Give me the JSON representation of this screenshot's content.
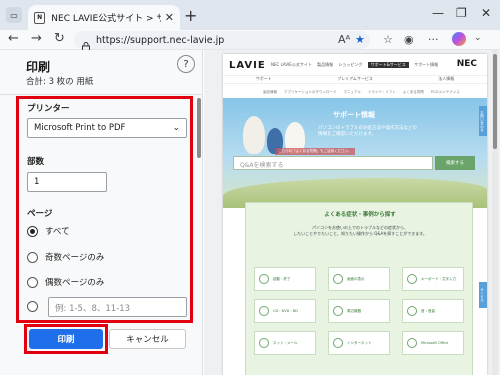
{
  "browser": {
    "tab_title": "NEC LAVIE公式サイト > サービス＆サ",
    "url": "https://support.nec-lavie.jp",
    "favicon_text": "N"
  },
  "dialog": {
    "title": "印刷",
    "subtitle": "合計: 3 枚の 用紙",
    "help_label": "?",
    "printer_label": "プリンター",
    "printer_value": "Microsoft Print to PDF",
    "copies_label": "部数",
    "copies_value": "1",
    "pages_label": "ページ",
    "page_options": [
      "すべて",
      "奇数ページのみ",
      "偶数ページのみ"
    ],
    "range_placeholder": "例: 1-5、8、11-13",
    "print_button": "印刷",
    "cancel_button": "キャンセル"
  },
  "preview": {
    "logo": "LAVIE",
    "brand": "NEC",
    "topnav": [
      "NEC LAVIE公式サイト",
      "製品情報",
      "ショッピング",
      "サポート情報"
    ],
    "topnav_active": "サポート&サービス",
    "subnav": [
      "サポート",
      "プレミアムサービス",
      "法人情報"
    ],
    "subnav2": "製品情報　　アプリケーションのダウンロード　　マニュアル　　ドライバ・ソフト　　よくある質問　　PCのメンテナンス",
    "hero_title": "サポート情報",
    "hero_text": "パソコンのトラブルの対処方法や操作方法などの\n情報をご確認いただけます。",
    "hero_tag": "こちらの「よくある質問」もご活用ください。",
    "search_placeholder": "Q&Aを検索する",
    "search_button": "検索する",
    "side_tab_1": "お問い合わせ",
    "side_tab_2": "サービス",
    "faq_title": "よくある症状・事例から探す",
    "faq_desc": "パソコンをお使いの上でのトラブルなどの症状から、\nしたいことやりたいこと、知りたい操作から Q&Aを探すことができます。",
    "tiles": [
      "起動・終了",
      "画面の表示",
      "キーボード・文字入力",
      "CD・DVD・BD",
      "周辺機器",
      "音・音量",
      "ネット・メール",
      "インターネット",
      "Microsoft Office"
    ]
  }
}
